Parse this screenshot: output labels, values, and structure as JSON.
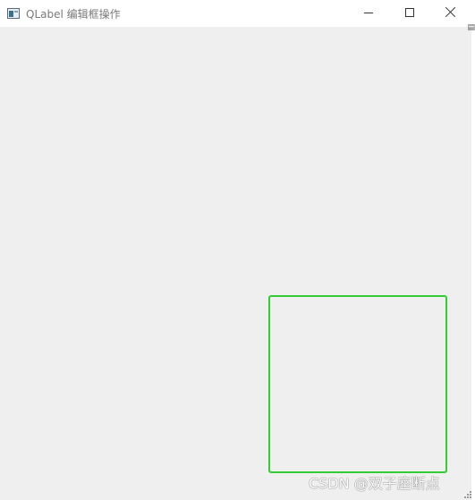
{
  "window": {
    "title": "QLabel 编辑框操作",
    "minimize_icon": "minimize-icon",
    "maximize_icon": "maximize-icon",
    "close_icon": "close-icon"
  },
  "canvas": {
    "edit_box": {
      "border_color": "#33cc33",
      "background": "transparent"
    }
  },
  "watermark": {
    "text": "CSDN @双子座断点"
  },
  "colors": {
    "client_bg": "#efefef",
    "titlebar_bg": "#ffffff",
    "title_text": "#7a7a7a"
  }
}
